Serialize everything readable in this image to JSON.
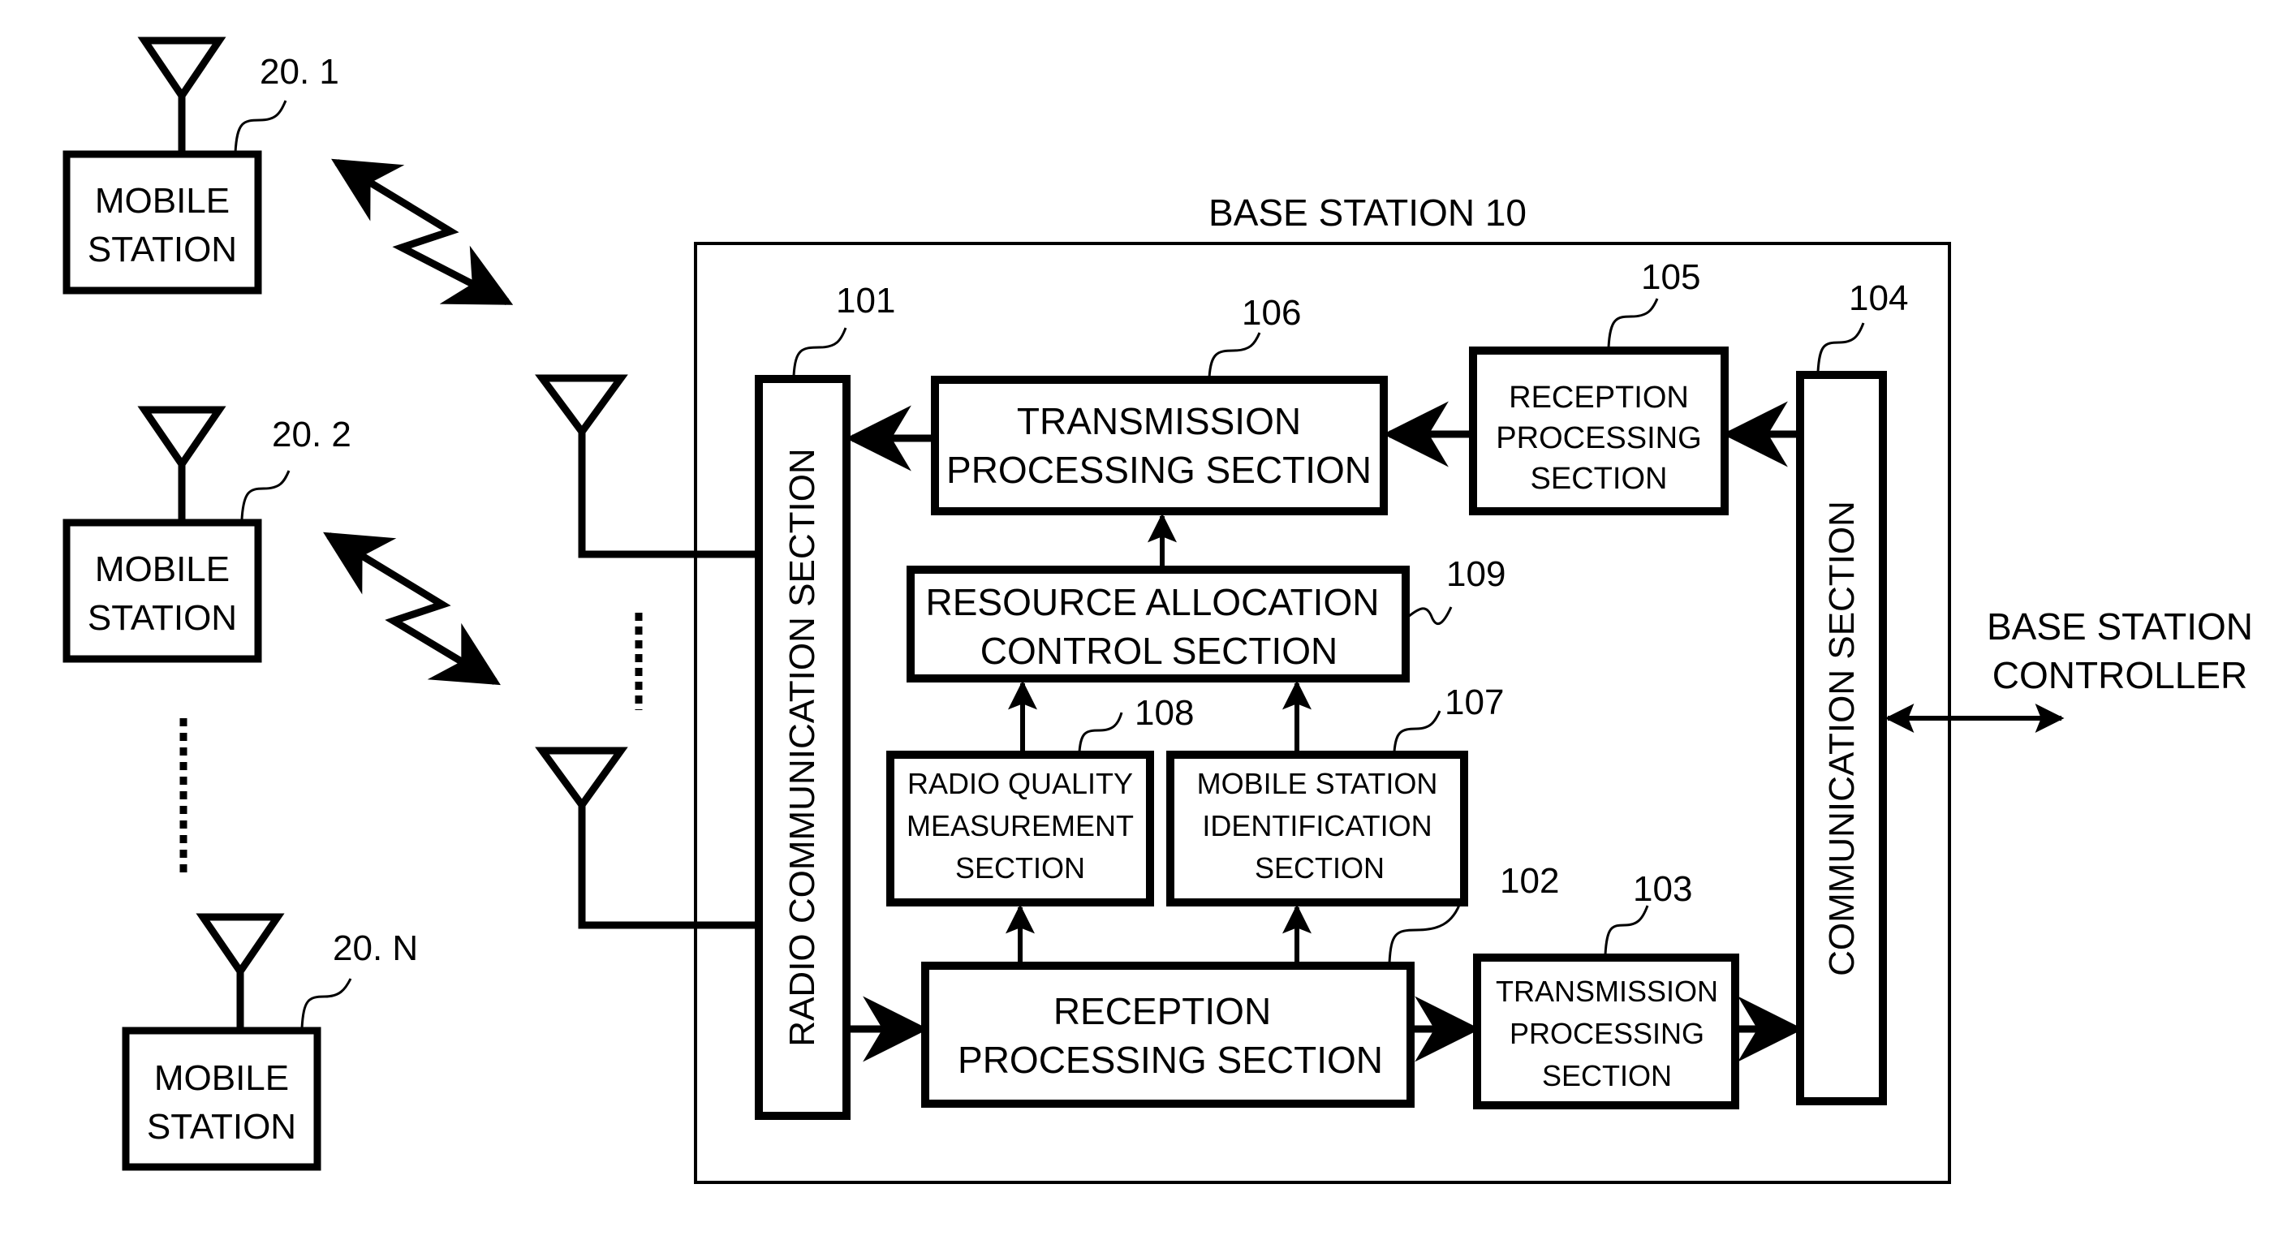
{
  "title": "BASE STATION 10",
  "colors": {
    "ink": "#000000",
    "paper": "#ffffff"
  },
  "mobile_stations": [
    {
      "ref": "20. 1",
      "line1": "MOBILE",
      "line2": "STATION"
    },
    {
      "ref": "20. 2",
      "line1": "MOBILE",
      "line2": "STATION"
    },
    {
      "ref": "20. N",
      "line1": "MOBILE",
      "line2": "STATION"
    }
  ],
  "blocks": {
    "radio_comm": {
      "ref": "101",
      "label": "RADIO COMMUNICATION SECTION"
    },
    "reception_main": {
      "ref": "102",
      "line1": "RECEPTION",
      "line2": "PROCESSING SECTION"
    },
    "transmission_uplink": {
      "ref": "103",
      "line1": "TRANSMISSION",
      "line2": "PROCESSING",
      "line3": "SECTION"
    },
    "comm": {
      "ref": "104",
      "label": "COMMUNICATION SECTION"
    },
    "reception_downlink": {
      "ref": "105",
      "line1": "RECEPTION",
      "line2": "PROCESSING",
      "line3": "SECTION"
    },
    "transmission_main": {
      "ref": "106",
      "line1": "TRANSMISSION",
      "line2": "PROCESSING SECTION"
    },
    "ms_identification": {
      "ref": "107",
      "line1": "MOBILE STATION",
      "line2": "IDENTIFICATION",
      "line3": "SECTION"
    },
    "radio_quality": {
      "ref": "108",
      "line1": "RADIO QUALITY",
      "line2": "MEASUREMENT",
      "line3": "SECTION"
    },
    "resource_alloc": {
      "ref": "109",
      "line1": "RESOURCE ALLOCATION",
      "line2": "CONTROL SECTION"
    }
  },
  "controller": {
    "line1": "BASE STATION",
    "line2": "CONTROLLER"
  },
  "icons": [
    "antenna-icon",
    "radio-link-icon",
    "ellipsis-dots-icon",
    "arrow-icon"
  ]
}
